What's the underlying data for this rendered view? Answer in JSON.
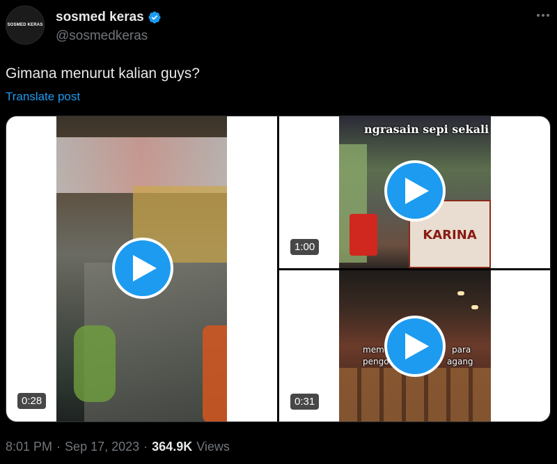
{
  "author": {
    "avatar_text": "SOSMED KERAS",
    "display_name": "sosmed keras",
    "handle": "@sosmedkeras",
    "verified": true
  },
  "post": {
    "text": "Gimana menurut kalian guys?",
    "translate_label": "Translate post"
  },
  "media": {
    "videos": [
      {
        "duration": "0:28"
      },
      {
        "duration": "1:00",
        "overlay_text": "ngrasain sepi sekali",
        "sign_text": "KARINA"
      },
      {
        "duration": "0:31",
        "overlay_text_left": "mem",
        "overlay_text_right": "para",
        "overlay_text_left2": "pengo",
        "overlay_text_right2": "agang"
      }
    ]
  },
  "meta": {
    "time": "8:01 PM",
    "separator": "·",
    "date": "Sep 17, 2023",
    "views_count": "364.9K",
    "views_label": "Views"
  },
  "colors": {
    "accent": "#1d9bf0",
    "muted": "#71767b",
    "text": "#e7e9ea",
    "background": "#000000"
  },
  "icons": [
    "verified-badge-icon",
    "more-options-icon",
    "play-icon"
  ]
}
